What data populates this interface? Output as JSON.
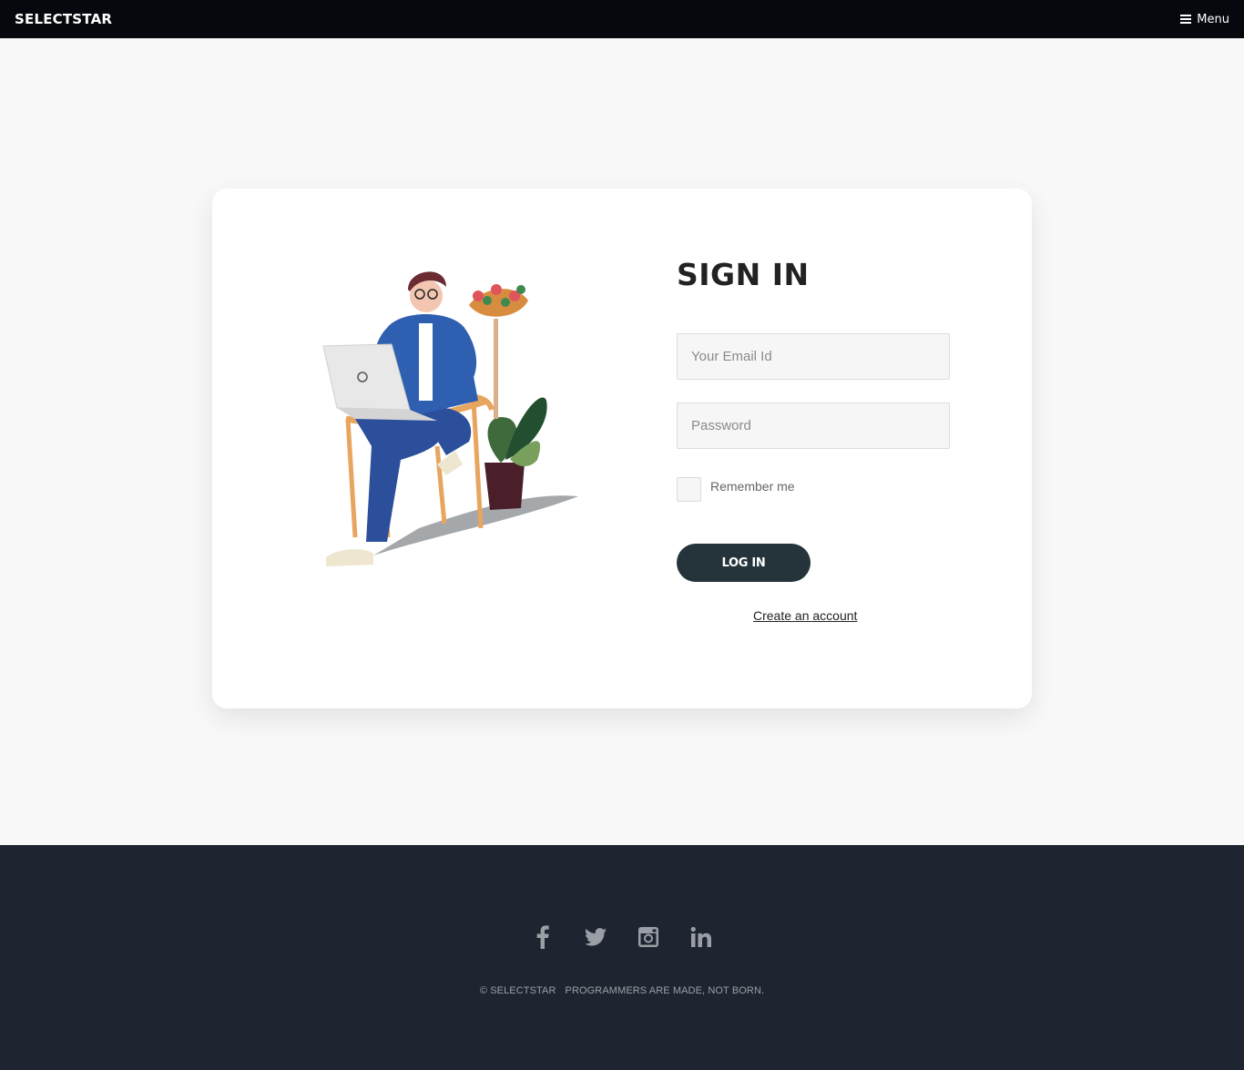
{
  "nav": {
    "brand": "SELECTSTAR",
    "menu_label": "Menu"
  },
  "signin": {
    "title": "SIGN IN",
    "email_placeholder": "Your Email Id",
    "password_placeholder": "Password",
    "remember_label": "Remember me",
    "login_label": "LOG IN",
    "create_account_label": "Create an account"
  },
  "footer": {
    "socials": [
      "facebook-icon",
      "twitter-icon",
      "instagram-icon",
      "linkedin-icon"
    ],
    "copyright": "© SELECTSTAR",
    "tagline": "PROGRAMMERS ARE MADE, NOT BORN."
  },
  "colors": {
    "topbar": "#05080d",
    "page_bg": "#f8f8f8",
    "button": "#25343a",
    "footer": "#1f2530"
  }
}
